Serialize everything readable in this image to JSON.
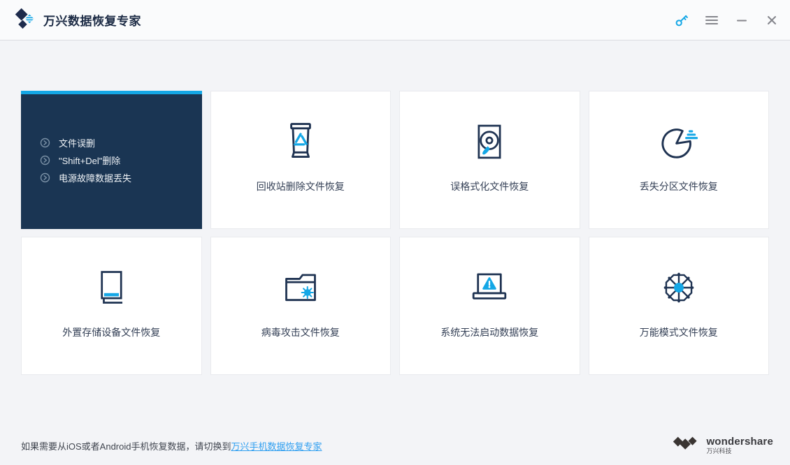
{
  "window": {
    "title": "万兴数据恢复专家",
    "titlebar_icons": [
      "key-icon",
      "menu-icon",
      "minimize-icon",
      "close-icon"
    ]
  },
  "scenario_card": {
    "items": [
      "文件误删",
      "\"Shift+Del\"删除",
      "电源故障数据丢失"
    ]
  },
  "modes": [
    {
      "label": "回收站删除文件恢复",
      "icon": "recycle-bin-icon"
    },
    {
      "label": "误格式化文件恢复",
      "icon": "hard-disk-icon"
    },
    {
      "label": "丢失分区文件恢复",
      "icon": "pie-partition-icon"
    },
    {
      "label": "外置存储设备文件恢复",
      "icon": "external-drive-icon"
    },
    {
      "label": "病毒攻击文件恢复",
      "icon": "folder-virus-icon"
    },
    {
      "label": "系统无法启动数据恢复",
      "icon": "laptop-warning-icon"
    },
    {
      "label": "万能模式文件恢复",
      "icon": "wheel-icon"
    }
  ],
  "footer": {
    "text": "如果需要从iOS或者Android手机恢复数据，请切换到",
    "link": "万兴手机数据恢复专家",
    "brand_name": "wondershare",
    "brand_sub": "万兴科技"
  },
  "colors": {
    "accent_blue": "#14a7e6",
    "icon_navy": "#1f3352",
    "dark_card_bg": "#1a3553",
    "link_blue": "#2d9ef0"
  }
}
